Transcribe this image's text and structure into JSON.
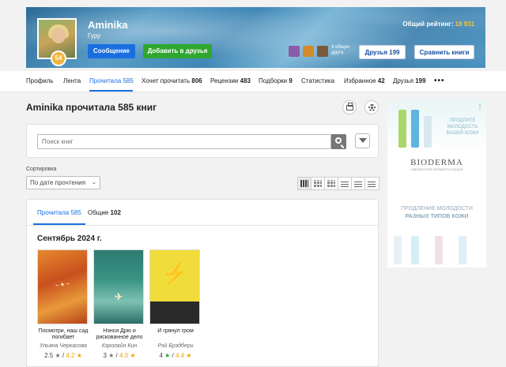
{
  "header": {
    "username": "Aminika",
    "rank": "Гуру",
    "level": "54",
    "rating_label": "Общий рейтинг:",
    "rating_value": "18 931",
    "message_btn": "Сообщение",
    "add_friend_btn": "Добавить в друзья",
    "common_friends": "4 общих друга",
    "friends_btn": "Друзья 199",
    "compare_btn": "Сравнить книги"
  },
  "nav": {
    "items": [
      {
        "label": "Профиль",
        "count": ""
      },
      {
        "label": "Лента",
        "count": ""
      },
      {
        "label": "Прочитала",
        "count": "585"
      },
      {
        "label": "Хочет прочитать",
        "count": "806"
      },
      {
        "label": "Рецензии",
        "count": "483"
      },
      {
        "label": "Подборки",
        "count": "9"
      },
      {
        "label": "Статистика",
        "count": ""
      },
      {
        "label": "Избранное",
        "count": "42"
      },
      {
        "label": "Друзья",
        "count": "199"
      }
    ],
    "more": "•••"
  },
  "page": {
    "title": "Aminika прочитала 585 книг",
    "search_placeholder": "Поиск книг",
    "sort_label": "Сортировка",
    "sort_value": "По дате прочтения",
    "tab_read": "Прочитала 585",
    "tab_common_label": "Общие",
    "tab_common_count": "102",
    "month": "Сентябрь 2024 г."
  },
  "books": [
    {
      "title": "Посмотри, наш сад погибает",
      "author": "Ульяна Черкасова",
      "user_rating": "2.5",
      "avg_rating": "4.2",
      "cover_color": "#d5652a"
    },
    {
      "title": "Нэнси Дрю и рискованное дело",
      "author": "Кэролайн Кин",
      "user_rating": "3",
      "avg_rating": "4.0",
      "cover_color": "#3a9384"
    },
    {
      "title": "И грянул гром",
      "author": "Рэй Брэдбери",
      "user_rating": "4",
      "avg_rating": "4.4",
      "cover_color": "#f0dc3a"
    }
  ],
  "ad": {
    "headline": "ПРОДЛИТЕ МОЛОДОСТЬ ВАШЕЙ КОЖИ",
    "brand": "BIODERMA",
    "brand_sub": "LABORATOIRE DERMATOLOGIQUE",
    "tagline1": "ПРОДЛЕНИЕ МОЛОДОСТИ",
    "tagline2": "РАЗНЫХ ТИПОВ КОЖИ"
  }
}
